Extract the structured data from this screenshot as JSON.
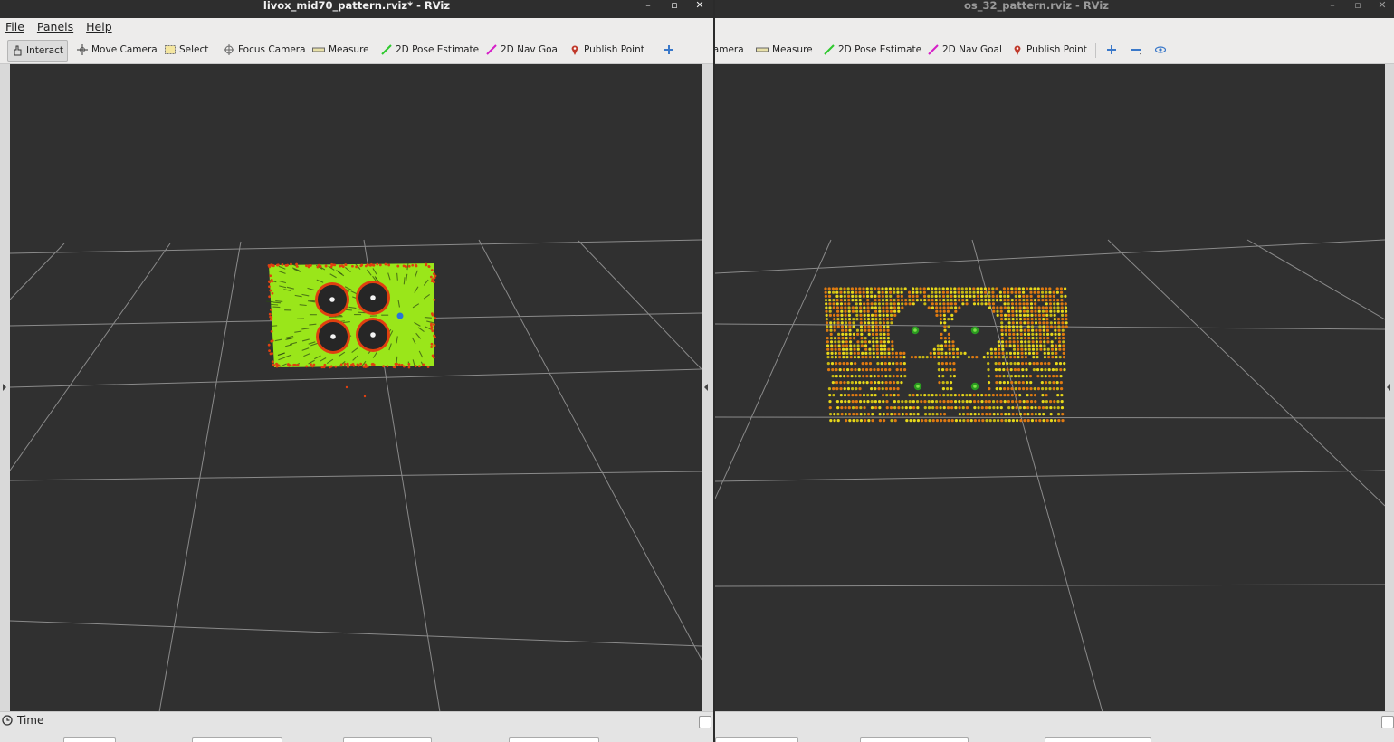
{
  "left_window": {
    "title": "livox_mid70_pattern.rviz* - RViz",
    "controls": {
      "minimize": "–",
      "maximize": "▫",
      "close": "✕"
    },
    "menu": [
      "File",
      "Panels",
      "Help"
    ],
    "toolbar": {
      "interact": "Interact",
      "move_camera": "Move Camera",
      "select": "Select",
      "focus_camera": "Focus Camera",
      "measure": "Measure",
      "pose_estimate": "2D Pose Estimate",
      "nav_goal": "2D Nav Goal",
      "publish_point": "Publish Point",
      "add_tool_icon": "plus-icon"
    },
    "status": {
      "time_label": "Time"
    }
  },
  "right_window": {
    "title": "os_32_pattern.rviz - RViz",
    "controls": {
      "minimize": "–",
      "maximize": "▫",
      "close": "✕"
    },
    "toolbar": {
      "overflow": "»",
      "camera_fragment": "amera",
      "measure": "Measure",
      "pose_estimate": "2D Pose Estimate",
      "nav_goal": "2D Nav Goal",
      "publish_point": "Publish Point",
      "add_tool_icon": "plus-icon",
      "remove_tool_icon": "minus-icon",
      "view_icon": "eye-icon"
    }
  },
  "colors": {
    "viewport_bg": "#303030",
    "grid": "#8a8a8a",
    "cloud_green": "#9ae61a",
    "cloud_red": "#e04010",
    "cloud_yellow": "#e8d81a",
    "circle_center_green": "#2a9a20"
  }
}
